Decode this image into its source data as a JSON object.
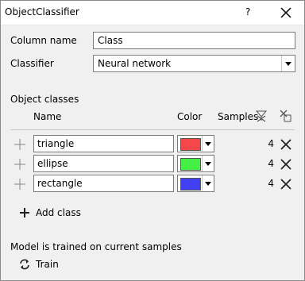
{
  "window": {
    "title": "ObjectClassifier",
    "help_label": "?",
    "close_icon": "close-icon"
  },
  "form": {
    "column_name_label": "Column name",
    "column_name_value": "Class",
    "classifier_label": "Classifier",
    "classifier_value": "Neural network"
  },
  "classes": {
    "section_label": "Object classes",
    "headers": {
      "name": "Name",
      "color": "Color",
      "samples": "Samples",
      "clear_samples_icon": "clear-filter-icon",
      "delete_all_icon": "delete-all-icon"
    },
    "rows": [
      {
        "name": "triangle",
        "color": "#f44848",
        "samples": "4"
      },
      {
        "name": "ellipse",
        "color": "#44f044",
        "samples": "4"
      },
      {
        "name": "rectangle",
        "color": "#3f3ff4",
        "samples": "4"
      }
    ],
    "add_label": "Add class"
  },
  "model": {
    "status": "Model is trained on current samples",
    "train_label": "Train"
  }
}
